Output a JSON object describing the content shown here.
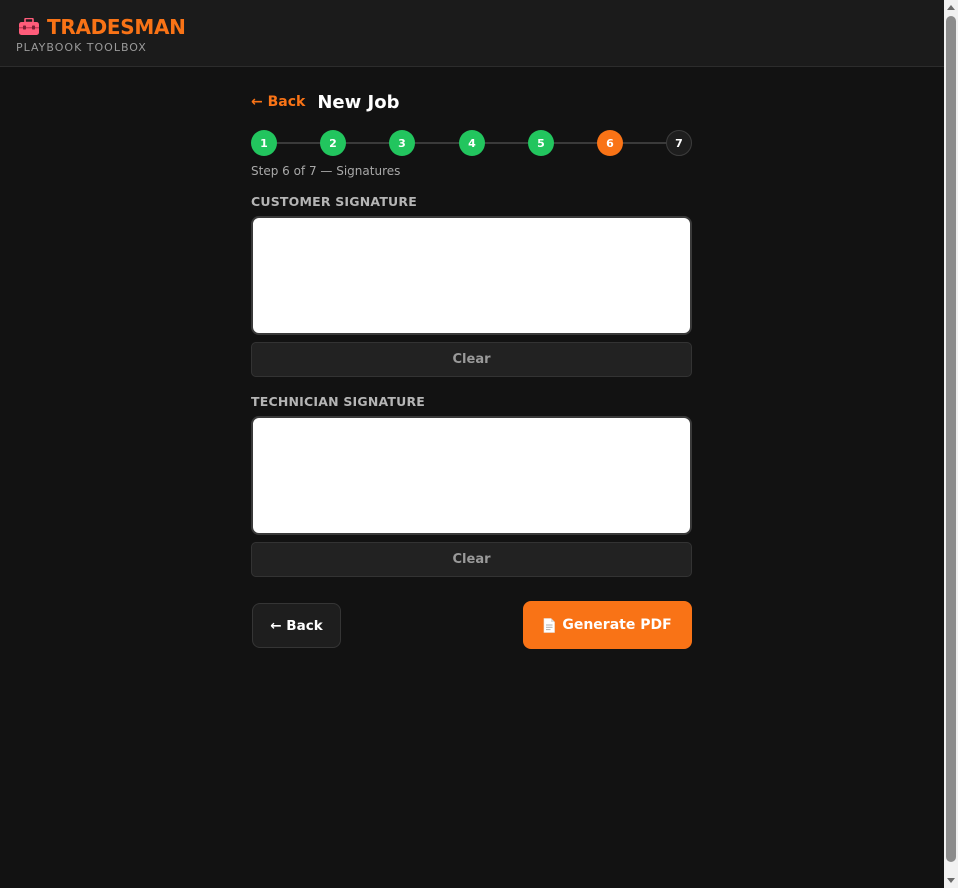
{
  "brand": {
    "name": "TRADESMAN",
    "subtitle": "PLAYBOOK TOOLBOX",
    "icon": "toolbox-icon",
    "accent": "#f97316"
  },
  "header": {
    "back_label": "← Back",
    "title": "New Job"
  },
  "stepper": {
    "steps": [
      {
        "label": "1",
        "state": "done"
      },
      {
        "label": "2",
        "state": "done"
      },
      {
        "label": "3",
        "state": "done"
      },
      {
        "label": "4",
        "state": "done"
      },
      {
        "label": "5",
        "state": "done"
      },
      {
        "label": "6",
        "state": "current"
      },
      {
        "label": "7",
        "state": "todo"
      }
    ],
    "caption": "Step 6 of 7 — Signatures",
    "colors": {
      "done": "#22c55e",
      "current": "#f97316",
      "todo": "#1e1e1e"
    }
  },
  "customer_signature": {
    "label": "CUSTOMER SIGNATURE",
    "clear_label": "Clear"
  },
  "technician_signature": {
    "label": "TECHNICIAN SIGNATURE",
    "clear_label": "Clear"
  },
  "actions": {
    "back_label": "← Back",
    "generate_label": "Generate PDF",
    "generate_icon": "document-icon"
  }
}
